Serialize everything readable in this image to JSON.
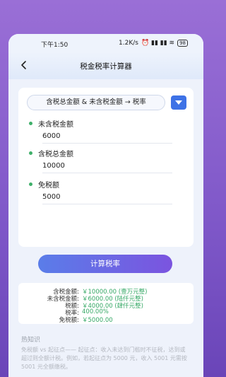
{
  "status": {
    "time": "下午1:50",
    "speed": "1.2K/s",
    "icons": "⏰ ▮▮ ▮▮ ≋",
    "battery": "98"
  },
  "nav": {
    "title": "税金税率计算器"
  },
  "mode": {
    "label": "含税总金额 & 未含税金额 → 税率"
  },
  "fields": [
    {
      "label": "未含税金额",
      "value": "6000"
    },
    {
      "label": "含税总金额",
      "value": "10000"
    },
    {
      "label": "免税额",
      "value": "5000"
    }
  ],
  "button": {
    "label": "计算税率"
  },
  "results": [
    {
      "label": "含税金额:",
      "value": "￥10000.00 (壹万元整)"
    },
    {
      "label": "未含税金额:",
      "value": "￥6000.00 (陆仟元整)"
    },
    {
      "label": "税额:",
      "value": "￥4000.00 (肆仟元整)"
    },
    {
      "label": "税率:",
      "value": "400.00%"
    },
    {
      "label": "免税额:",
      "value": "￥5000.00"
    }
  ],
  "knowledge": {
    "title": "热知识",
    "text": "免税额 vs 起征点——\n起征点：收入未达到门槛时不征税，达到或超过则全额计税。例如，若起征点为 5000 元，收入 5001 元需按 5001 元全额缴税。"
  },
  "colors": {
    "accent": "#3e72e6",
    "green": "#35a865",
    "purple": "#7e57c8"
  }
}
